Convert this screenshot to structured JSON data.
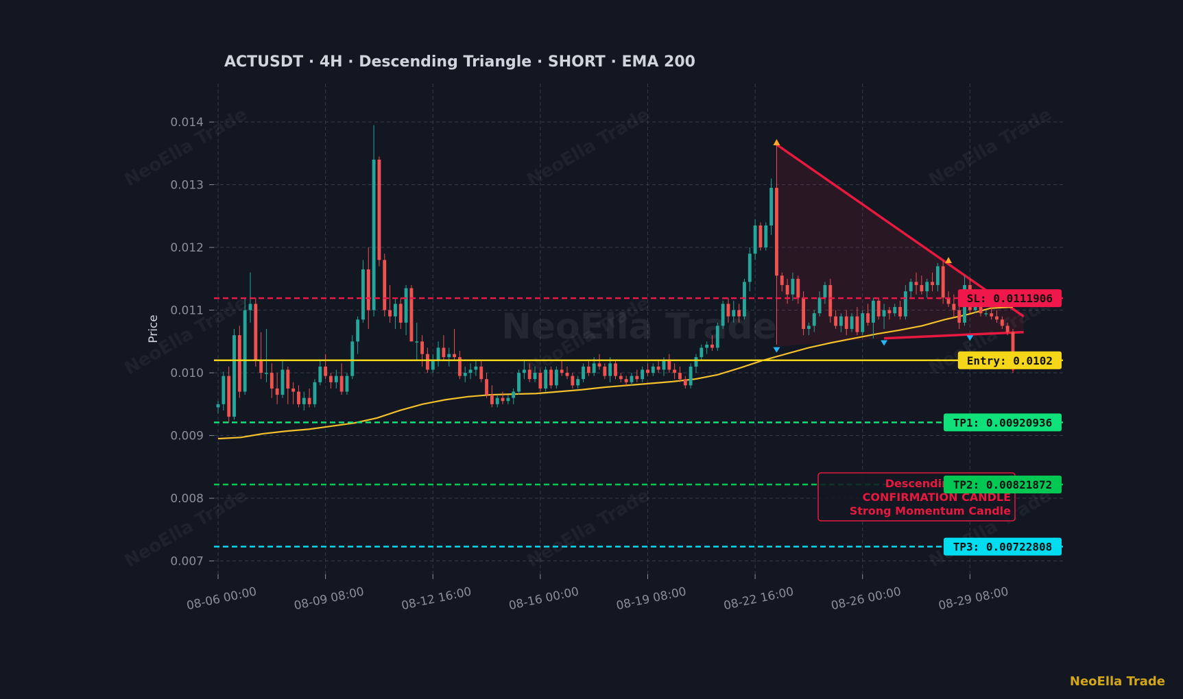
{
  "chart_data": {
    "type": "candlestick",
    "title": "ACTUSDT  ·  4H  ·  Descending Triangle  ·  SHORT  ·  EMA 200",
    "ylabel": "Price",
    "ylim": [
      0.0067,
      0.01453
    ],
    "y_ticks": [
      "0.007",
      "0.008",
      "0.009",
      "0.010",
      "0.011",
      "0.012",
      "0.013",
      "0.014"
    ],
    "x_ticks": [
      "08-06 00:00",
      "08-09 08:00",
      "08-12 16:00",
      "08-16 00:00",
      "08-19 08:00",
      "08-22 16:00",
      "08-26 00:00",
      "08-29 08:00"
    ],
    "grid": true,
    "watermark": "NeoElla Trade",
    "candles_ohlc": [
      [
        0.00945,
        0.00955,
        0.00935,
        0.0095
      ],
      [
        0.0095,
        0.01002,
        0.0094,
        0.00995
      ],
      [
        0.00995,
        0.0101,
        0.0092,
        0.0093
      ],
      [
        0.0093,
        0.0107,
        0.00925,
        0.0106
      ],
      [
        0.0106,
        0.01075,
        0.0096,
        0.0097
      ],
      [
        0.0097,
        0.0112,
        0.00965,
        0.011
      ],
      [
        0.011,
        0.0116,
        0.0108,
        0.0111
      ],
      [
        0.0111,
        0.0112,
        0.0101,
        0.0102
      ],
      [
        0.0102,
        0.01065,
        0.0099,
        0.01
      ],
      [
        0.01,
        0.0107,
        0.00985,
        0.01
      ],
      [
        0.01,
        0.01015,
        0.0096,
        0.00975
      ],
      [
        0.00975,
        0.01,
        0.0095,
        0.00965
      ],
      [
        0.00965,
        0.0102,
        0.0096,
        0.01005
      ],
      [
        0.01005,
        0.0101,
        0.0095,
        0.00975
      ],
      [
        0.00975,
        0.00985,
        0.0095,
        0.0097
      ],
      [
        0.0097,
        0.0098,
        0.00945,
        0.0095
      ],
      [
        0.0095,
        0.0097,
        0.0094,
        0.0096
      ],
      [
        0.0096,
        0.00975,
        0.00945,
        0.0095
      ],
      [
        0.0095,
        0.0099,
        0.00945,
        0.00985
      ],
      [
        0.00985,
        0.0102,
        0.0098,
        0.0101
      ],
      [
        0.0101,
        0.0103,
        0.0099,
        0.00995
      ],
      [
        0.00995,
        0.01,
        0.00975,
        0.00985
      ],
      [
        0.00985,
        0.01005,
        0.00975,
        0.00995
      ],
      [
        0.00995,
        0.01015,
        0.00965,
        0.0097
      ],
      [
        0.0097,
        0.01,
        0.00965,
        0.00995
      ],
      [
        0.00995,
        0.0106,
        0.0099,
        0.0105
      ],
      [
        0.0105,
        0.0109,
        0.0103,
        0.01085
      ],
      [
        0.01085,
        0.0118,
        0.0108,
        0.01165
      ],
      [
        0.01165,
        0.012,
        0.0107,
        0.011
      ],
      [
        0.011,
        0.01395,
        0.0109,
        0.0134
      ],
      [
        0.0134,
        0.01345,
        0.0117,
        0.0118
      ],
      [
        0.0118,
        0.0119,
        0.0109,
        0.011
      ],
      [
        0.011,
        0.0114,
        0.0108,
        0.0109
      ],
      [
        0.0109,
        0.0112,
        0.0107,
        0.0111
      ],
      [
        0.0111,
        0.0112,
        0.0107,
        0.0108
      ],
      [
        0.0108,
        0.0114,
        0.0106,
        0.01135
      ],
      [
        0.01135,
        0.0114,
        0.0106,
        0.0105
      ],
      [
        0.0105,
        0.0108,
        0.0102,
        0.0105
      ],
      [
        0.0105,
        0.0106,
        0.0101,
        0.0103
      ],
      [
        0.0103,
        0.0104,
        0.01,
        0.01005
      ],
      [
        0.01005,
        0.0103,
        0.01,
        0.0102
      ],
      [
        0.0102,
        0.0105,
        0.0101,
        0.0104
      ],
      [
        0.0104,
        0.0106,
        0.0102,
        0.01025
      ],
      [
        0.01025,
        0.0104,
        0.0101,
        0.0103
      ],
      [
        0.0103,
        0.0107,
        0.0102,
        0.01025
      ],
      [
        0.01025,
        0.01035,
        0.0099,
        0.00995
      ],
      [
        0.00995,
        0.0101,
        0.00985,
        0.01
      ],
      [
        0.01,
        0.01015,
        0.0099,
        0.01005
      ],
      [
        0.01005,
        0.0102,
        0.00995,
        0.0101
      ],
      [
        0.0101,
        0.0102,
        0.00985,
        0.0099
      ],
      [
        0.0099,
        0.01,
        0.0096,
        0.00965
      ],
      [
        0.00965,
        0.0098,
        0.00945,
        0.0095
      ],
      [
        0.0095,
        0.00965,
        0.00945,
        0.0096
      ],
      [
        0.0096,
        0.0097,
        0.0095,
        0.00955
      ],
      [
        0.00955,
        0.00965,
        0.0095,
        0.0096
      ],
      [
        0.0096,
        0.00975,
        0.0095,
        0.0097
      ],
      [
        0.0097,
        0.01005,
        0.00965,
        0.01
      ],
      [
        0.01,
        0.0102,
        0.0099,
        0.01005
      ],
      [
        0.01005,
        0.01015,
        0.00985,
        0.0099
      ],
      [
        0.0099,
        0.0101,
        0.00985,
        0.01
      ],
      [
        0.01,
        0.01005,
        0.0097,
        0.00975
      ],
      [
        0.00975,
        0.0101,
        0.0097,
        0.01005
      ],
      [
        0.01005,
        0.0101,
        0.00975,
        0.0098
      ],
      [
        0.0098,
        0.0101,
        0.00975,
        0.01005
      ],
      [
        0.01005,
        0.0102,
        0.00995,
        0.01
      ],
      [
        0.01,
        0.0101,
        0.0099,
        0.00995
      ],
      [
        0.00995,
        0.01,
        0.00975,
        0.0098
      ],
      [
        0.0098,
        0.00995,
        0.00975,
        0.0099
      ],
      [
        0.0099,
        0.01015,
        0.00985,
        0.0101
      ],
      [
        0.0101,
        0.0102,
        0.00995,
        0.01
      ],
      [
        0.01,
        0.01025,
        0.00995,
        0.01015
      ],
      [
        0.01015,
        0.0103,
        0.01005,
        0.0101
      ],
      [
        0.0101,
        0.01015,
        0.0099,
        0.00995
      ],
      [
        0.00995,
        0.01025,
        0.00985,
        0.01015
      ],
      [
        0.01015,
        0.0102,
        0.0099,
        0.00995
      ],
      [
        0.00995,
        0.01,
        0.00985,
        0.0099
      ],
      [
        0.0099,
        0.00995,
        0.0098,
        0.00985
      ],
      [
        0.00985,
        0.01,
        0.0098,
        0.00995
      ],
      [
        0.00995,
        0.01005,
        0.00985,
        0.0099
      ],
      [
        0.0099,
        0.0101,
        0.00985,
        0.01005
      ],
      [
        0.01005,
        0.01015,
        0.00995,
        0.01
      ],
      [
        0.01,
        0.01015,
        0.00995,
        0.0101
      ],
      [
        0.0101,
        0.0102,
        0.01,
        0.01005
      ],
      [
        0.01005,
        0.01025,
        0.00995,
        0.0102
      ],
      [
        0.0102,
        0.0103,
        0.01,
        0.01005
      ],
      [
        0.01005,
        0.01015,
        0.0099,
        0.01
      ],
      [
        0.01,
        0.0101,
        0.00985,
        0.0099
      ],
      [
        0.0099,
        0.00995,
        0.00975,
        0.0098
      ],
      [
        0.0098,
        0.01015,
        0.00975,
        0.0101
      ],
      [
        0.0101,
        0.0103,
        0.01,
        0.01025
      ],
      [
        0.01025,
        0.01045,
        0.0102,
        0.0104
      ],
      [
        0.0104,
        0.0105,
        0.0103,
        0.01045
      ],
      [
        0.01045,
        0.0106,
        0.01035,
        0.0104
      ],
      [
        0.0104,
        0.0108,
        0.01035,
        0.01075
      ],
      [
        0.01075,
        0.01115,
        0.0107,
        0.0111
      ],
      [
        0.0111,
        0.0112,
        0.0108,
        0.0109
      ],
      [
        0.0109,
        0.01115,
        0.0108,
        0.011
      ],
      [
        0.011,
        0.0111,
        0.0108,
        0.0109
      ],
      [
        0.0109,
        0.0115,
        0.01085,
        0.01145
      ],
      [
        0.01145,
        0.012,
        0.0113,
        0.0119
      ],
      [
        0.0119,
        0.01245,
        0.0118,
        0.01235
      ],
      [
        0.01235,
        0.0124,
        0.01195,
        0.012
      ],
      [
        0.012,
        0.0124,
        0.01195,
        0.01235
      ],
      [
        0.01235,
        0.0131,
        0.0122,
        0.01295
      ],
      [
        0.01295,
        0.01365,
        0.01045,
        0.01155
      ],
      [
        0.01155,
        0.0116,
        0.0113,
        0.0114
      ],
      [
        0.0114,
        0.0115,
        0.0111,
        0.01125
      ],
      [
        0.01125,
        0.0116,
        0.01115,
        0.0115
      ],
      [
        0.0115,
        0.01155,
        0.0111,
        0.0112
      ],
      [
        0.0112,
        0.0113,
        0.0106,
        0.0107
      ],
      [
        0.0107,
        0.0108,
        0.0106,
        0.01075
      ],
      [
        0.01075,
        0.011,
        0.01065,
        0.01095
      ],
      [
        0.01095,
        0.0113,
        0.0109,
        0.0112
      ],
      [
        0.0112,
        0.01145,
        0.0111,
        0.0114
      ],
      [
        0.0114,
        0.0115,
        0.0108,
        0.0109
      ],
      [
        0.0109,
        0.011,
        0.0107,
        0.01075
      ],
      [
        0.01075,
        0.01095,
        0.01065,
        0.0109
      ],
      [
        0.0109,
        0.011,
        0.0106,
        0.0107
      ],
      [
        0.0107,
        0.01095,
        0.01065,
        0.0109
      ],
      [
        0.0109,
        0.01105,
        0.0106,
        0.01065
      ],
      [
        0.01065,
        0.011,
        0.0106,
        0.01095
      ],
      [
        0.01095,
        0.0111,
        0.01075,
        0.0108
      ],
      [
        0.0108,
        0.0112,
        0.01055,
        0.01115
      ],
      [
        0.01115,
        0.0112,
        0.01085,
        0.0109
      ],
      [
        0.0109,
        0.0111,
        0.0107,
        0.011
      ],
      [
        0.011,
        0.01105,
        0.01085,
        0.01095
      ],
      [
        0.01095,
        0.0111,
        0.0109,
        0.01105
      ],
      [
        0.01105,
        0.01115,
        0.01085,
        0.0109
      ],
      [
        0.0109,
        0.0114,
        0.01085,
        0.0113
      ],
      [
        0.0113,
        0.0115,
        0.0112,
        0.01145
      ],
      [
        0.01145,
        0.0116,
        0.01125,
        0.0114
      ],
      [
        0.0114,
        0.01155,
        0.01125,
        0.0113
      ],
      [
        0.0113,
        0.0115,
        0.0112,
        0.01145
      ],
      [
        0.01145,
        0.0116,
        0.0113,
        0.0114
      ],
      [
        0.0114,
        0.01175,
        0.0113,
        0.0117
      ],
      [
        0.0117,
        0.0118,
        0.0111,
        0.0112
      ],
      [
        0.0112,
        0.0113,
        0.01105,
        0.0111
      ],
      [
        0.0111,
        0.01125,
        0.0109,
        0.011
      ],
      [
        0.011,
        0.0111,
        0.0107,
        0.0108
      ],
      [
        0.0108,
        0.01155,
        0.01075,
        0.0114
      ],
      [
        0.0114,
        0.0115,
        0.01095,
        0.011
      ],
      [
        0.011,
        0.0111,
        0.01095,
        0.01105
      ],
      [
        0.01105,
        0.0111,
        0.0109,
        0.01095
      ],
      [
        0.01095,
        0.011,
        0.0109,
        0.01095
      ],
      [
        0.01095,
        0.01105,
        0.01085,
        0.0109
      ],
      [
        0.0109,
        0.011,
        0.0108,
        0.01085
      ],
      [
        0.01085,
        0.0109,
        0.0107,
        0.01075
      ],
      [
        0.01075,
        0.0108,
        0.0106,
        0.01065
      ],
      [
        0.01065,
        0.0107,
        0.01,
        0.0101
      ]
    ],
    "ema": {
      "name": "EMA 200",
      "values": [
        0.00895,
        0.00897,
        0.00903,
        0.00907,
        0.0091,
        0.00915,
        0.0092,
        0.00928,
        0.0094,
        0.0095,
        0.00957,
        0.00962,
        0.00965,
        0.00966,
        0.00967,
        0.0097,
        0.00973,
        0.00977,
        0.0098,
        0.00983,
        0.00986,
        0.0099,
        0.00997,
        0.01008,
        0.0102,
        0.0103,
        0.0104,
        0.01048,
        0.01055,
        0.01062,
        0.01068,
        0.01075,
        0.01085,
        0.01093,
        0.01103,
        0.01105
      ]
    },
    "levels": [
      {
        "label": "SL: 0.0111906",
        "value": 0.0111906,
        "color": "#f0174a",
        "style": "dashed"
      },
      {
        "label": "Entry: 0.0102",
        "value": 0.0102,
        "color": "#f6d619",
        "style": "solid"
      },
      {
        "label": "TP1: 0.00920936",
        "value": 0.00920936,
        "color": "#10e07a",
        "style": "dashed"
      },
      {
        "label": "TP2: 0.00821872",
        "value": 0.00821872,
        "color": "#00c853",
        "style": "dashed"
      },
      {
        "label": "TP3: 0.00722808",
        "value": 0.00722808,
        "color": "#00dcf0",
        "style": "dashed"
      }
    ],
    "pattern": {
      "name": "Descending Triangle",
      "upper_line": [
        [
          104,
          0.01364
        ],
        [
          150,
          0.0109
        ]
      ],
      "lower_line": [
        [
          124,
          0.01055
        ],
        [
          150,
          0.01065
        ]
      ],
      "highs": [
        [
          104,
          0.01364
        ],
        [
          136,
          0.01176
        ]
      ],
      "lows": [
        [
          104,
          0.01042
        ],
        [
          124,
          0.01053
        ],
        [
          140,
          0.01061
        ]
      ]
    },
    "annotation": {
      "lines": [
        "Descending Triangle",
        "CONFIRMATION CANDLE",
        "Strong Momentum Candle"
      ]
    },
    "colors": {
      "background": "#131722",
      "up": "#26a69a",
      "down": "#ef5350",
      "grid": "#363c4e",
      "ema": "#f6c02b",
      "pattern": "#e8193f",
      "text": "#d1d4dc",
      "tick": "#8a8f9c"
    },
    "branding": "NeoElla Trade"
  }
}
